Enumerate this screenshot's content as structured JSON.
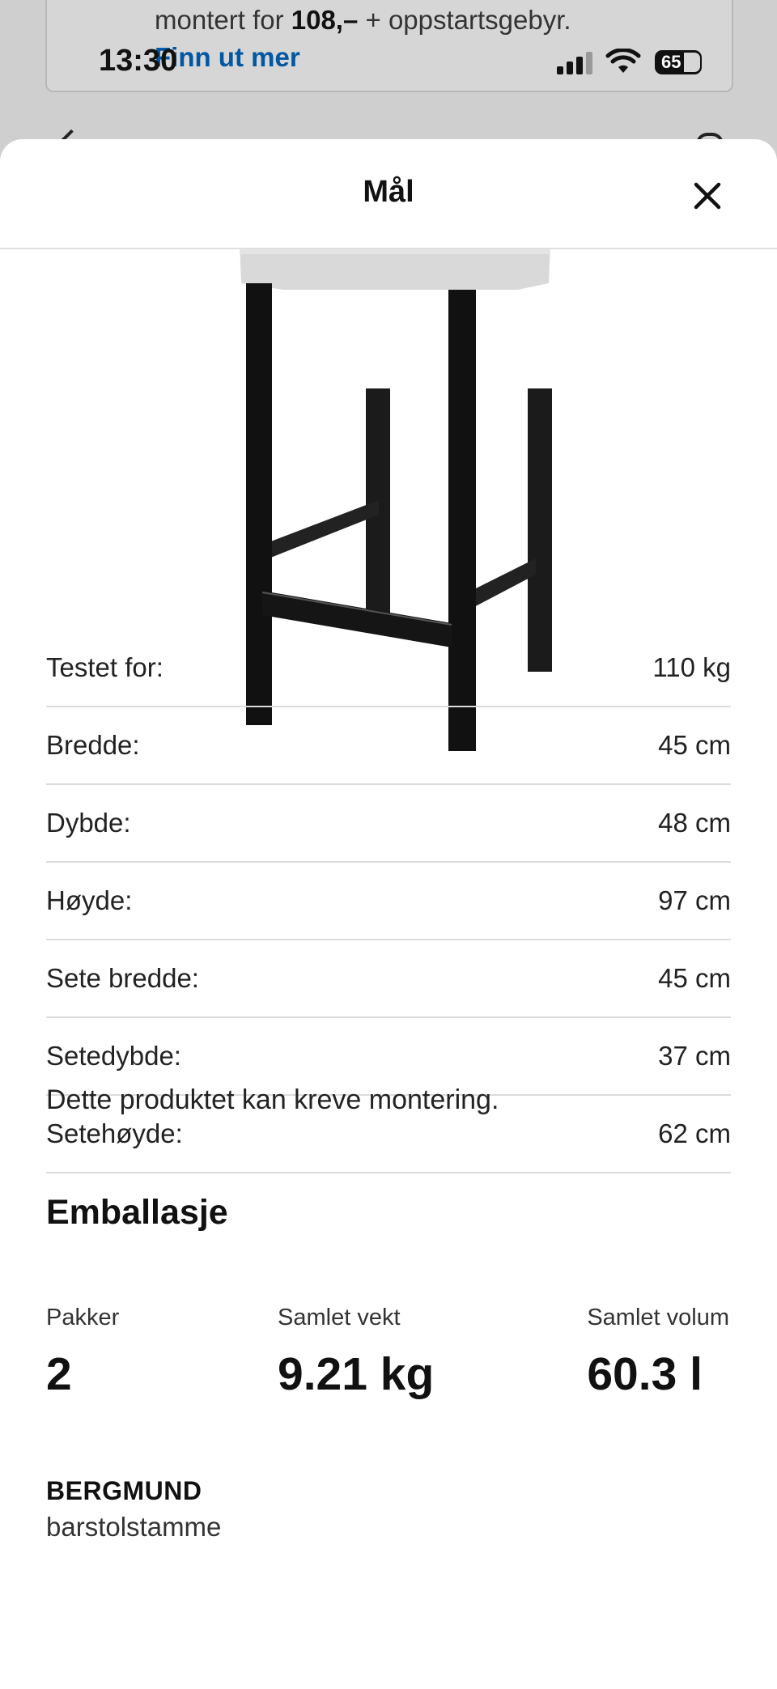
{
  "background": {
    "banner_line_text": "montert for",
    "banner_line_price": "108,–",
    "banner_line_tail": "+ oppstartsgebyr.",
    "banner_link": "Finn ut mer"
  },
  "status_bar": {
    "time": "13:30",
    "battery": "65"
  },
  "sheet": {
    "title": "Mål"
  },
  "dimensions": [
    {
      "label": "Testet for:",
      "value": "110 kg"
    },
    {
      "label": "Bredde:",
      "value": "45 cm"
    },
    {
      "label": "Dybde:",
      "value": "48 cm"
    },
    {
      "label": "Høyde:",
      "value": "97 cm"
    },
    {
      "label": "Sete bredde:",
      "value": "45 cm"
    },
    {
      "label": "Setedybde:",
      "value": "37 cm"
    },
    {
      "label": "Setehøyde:",
      "value": "62 cm"
    }
  ],
  "note": "Dette produktet kan kreve montering.",
  "packaging": {
    "heading": "Emballasje",
    "stats": [
      {
        "label": "Pakker",
        "value": "2"
      },
      {
        "label": "Samlet vekt",
        "value": "9.21 kg"
      },
      {
        "label": "Samlet volum",
        "value": "60.3 l"
      }
    ]
  },
  "item": {
    "name": "BERGMUND",
    "description": "barstolstamme"
  },
  "colors": {
    "link": "#0058a3",
    "divider": "#dcdcdc"
  }
}
